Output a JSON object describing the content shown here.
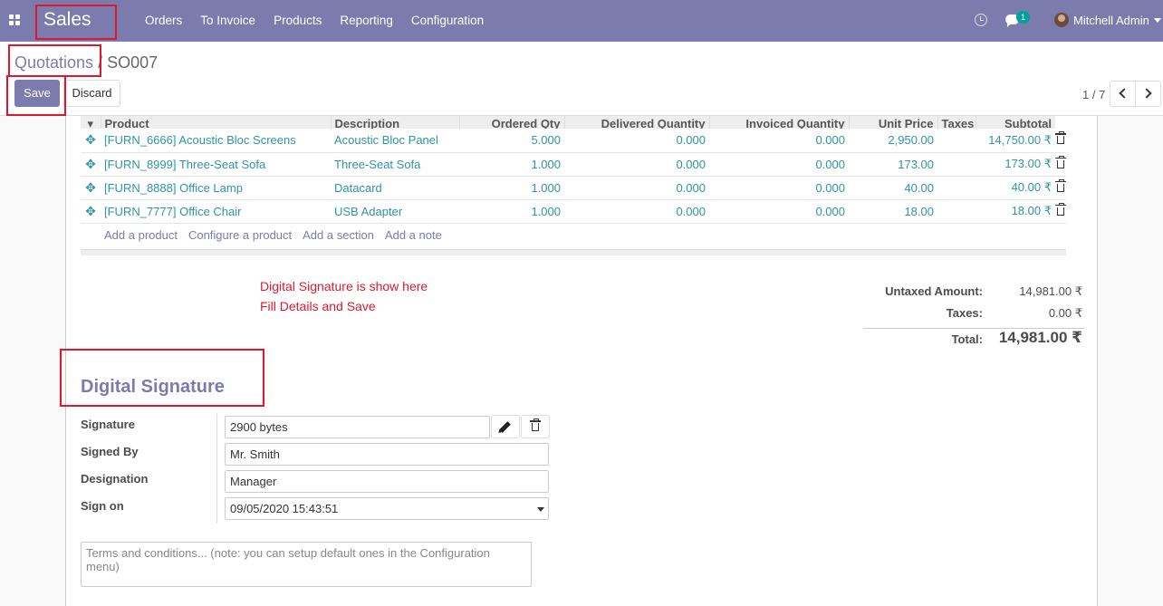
{
  "navbar": {
    "brand": "Sales",
    "menu": [
      "Orders",
      "To Invoice",
      "Products",
      "Reporting",
      "Configuration"
    ],
    "chat_count": "1",
    "user_name": "Mitchell Admin"
  },
  "breadcrumb": {
    "parent": "Quotations",
    "separator": "/",
    "current": "SO007"
  },
  "buttons": {
    "save": "Save",
    "discard": "Discard"
  },
  "pager": {
    "value": "1 / 7"
  },
  "order_lines": {
    "columns": [
      "Product",
      "Description",
      "Ordered Qty",
      "Delivered Quantity",
      "Invoiced Quantity",
      "Unit Price",
      "Taxes",
      "Subtotal"
    ],
    "rows": [
      {
        "product": "[FURN_6666] Acoustic Bloc Screens",
        "description": "Acoustic Bloc Panel",
        "ordered": "5.000",
        "delivered": "0.000",
        "invoiced": "0.000",
        "unit_price": "2,950.00",
        "taxes": "",
        "subtotal": "14,750.00 ₹"
      },
      {
        "product": "[FURN_8999] Three-Seat Sofa",
        "description": "Three-Seat Sofa",
        "ordered": "1.000",
        "delivered": "0.000",
        "invoiced": "0.000",
        "unit_price": "173.00",
        "taxes": "",
        "subtotal": "173.00 ₹"
      },
      {
        "product": "[FURN_8888] Office Lamp",
        "description": "Datacard",
        "ordered": "1.000",
        "delivered": "0.000",
        "invoiced": "0.000",
        "unit_price": "40.00",
        "taxes": "",
        "subtotal": "40.00 ₹"
      },
      {
        "product": "[FURN_7777] Office Chair",
        "description": "USB Adapter",
        "ordered": "1.000",
        "delivered": "0.000",
        "invoiced": "0.000",
        "unit_price": "18.00",
        "taxes": "",
        "subtotal": "18.00 ₹"
      }
    ],
    "add_links": [
      "Add a product",
      "Configure a product",
      "Add a section",
      "Add a note"
    ]
  },
  "annotation_note": {
    "line1": "Digital Signature is show here",
    "line2": "Fill Details and Save"
  },
  "totals": {
    "untaxed_label": "Untaxed Amount:",
    "untaxed_value": "14,981.00 ₹",
    "taxes_label": "Taxes:",
    "taxes_value": "0.00 ₹",
    "total_label": "Total:",
    "total_value": "14,981.00 ₹"
  },
  "digital_signature": {
    "title": "Digital Signature",
    "signature_label": "Signature",
    "signature_value": "2900 bytes",
    "signed_by_label": "Signed By",
    "signed_by_value": "Mr. Smith",
    "designation_label": "Designation",
    "designation_value": "Manager",
    "sign_on_label": "Sign on",
    "sign_on_value": "09/05/2020 15:43:51"
  },
  "terms": {
    "placeholder": "Terms and conditions... (note: you can setup default ones in the Configuration menu)"
  },
  "colors": {
    "primary": "#7c7bad",
    "link": "#2e94a6",
    "annotation": "#e0182d"
  }
}
